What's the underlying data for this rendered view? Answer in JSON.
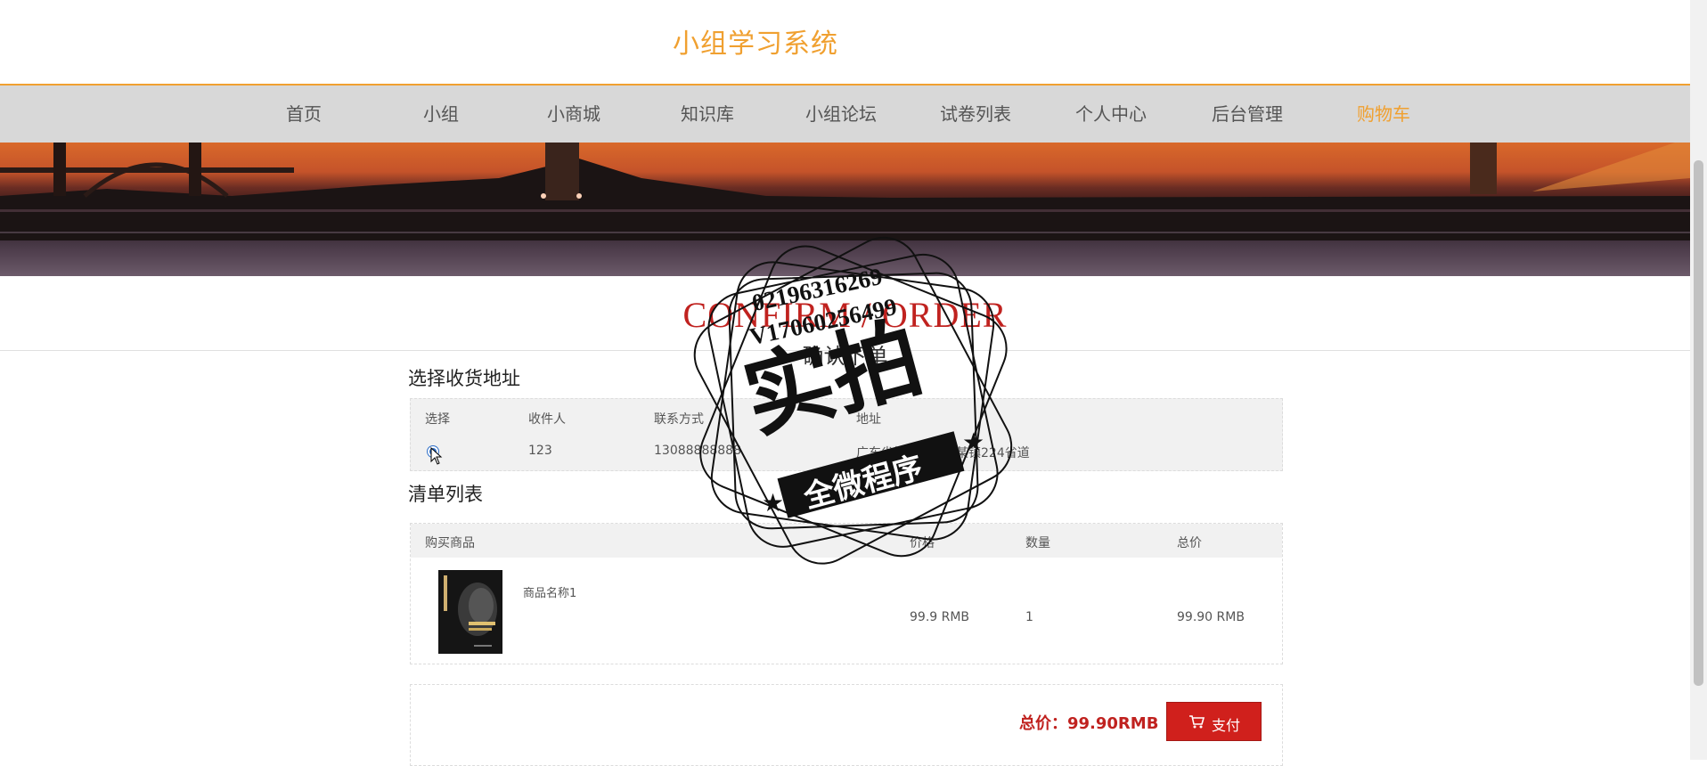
{
  "header": {
    "site_title": "小组学习系统"
  },
  "nav": {
    "items": [
      {
        "label": "首页",
        "active": false
      },
      {
        "label": "小组",
        "active": false
      },
      {
        "label": "小商城",
        "active": false
      },
      {
        "label": "知识库",
        "active": false
      },
      {
        "label": "小组论坛",
        "active": false
      },
      {
        "label": "试卷列表",
        "active": false
      },
      {
        "label": "个人中心",
        "active": false
      },
      {
        "label": "后台管理",
        "active": false
      },
      {
        "label": "购物车",
        "active": true
      }
    ]
  },
  "page_heading": {
    "en": "CONFIRM / ORDER",
    "cn": "确认下单"
  },
  "address": {
    "section_title": "选择收货地址",
    "columns": [
      "选择",
      "收件人",
      "联系方式",
      "地址"
    ],
    "rows": [
      {
        "selected": true,
        "recipient": "123",
        "phone": "13088888888",
        "address": "广东省梅州市某区某镇224省道"
      }
    ]
  },
  "cart": {
    "section_title": "清单列表",
    "columns": [
      "购买商品",
      "价格",
      "数量",
      "总价"
    ],
    "items": [
      {
        "name": "商品名称1",
        "price": "99.9 RMB",
        "quantity": "1",
        "total": "99.90 RMB",
        "icon": "book-cover-image"
      }
    ]
  },
  "summary": {
    "total_label": "总价：99.90RMB",
    "pay_label": "支付",
    "pay_icon": "cart-icon"
  },
  "watermark": {
    "numbers": [
      "02196316269",
      "V17060256499"
    ],
    "main_text": "实拍",
    "ribbon_text": "全微程序"
  },
  "colors": {
    "accent": "#f0a030",
    "red": "#c0221f",
    "button": "#d0201c"
  }
}
